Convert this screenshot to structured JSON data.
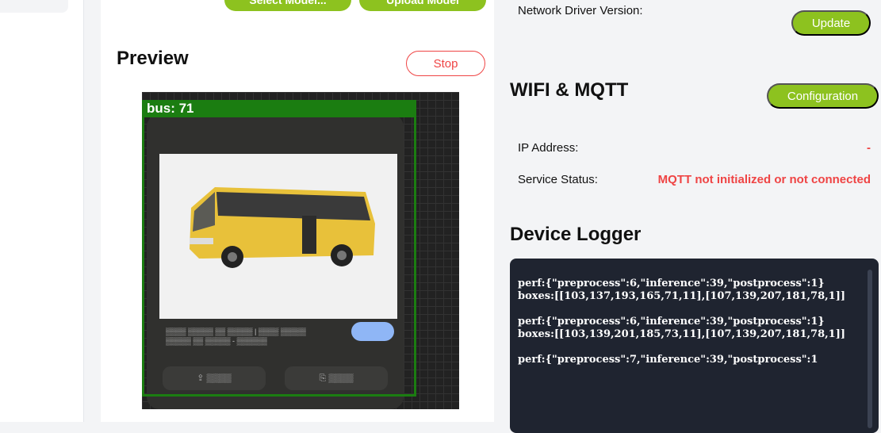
{
  "toolbar": {
    "select_model_label": "Select Model...",
    "upload_model_label": "Upload Model"
  },
  "preview": {
    "title": "Preview",
    "stop_label": "Stop",
    "detection_label": "bus: 71"
  },
  "driver": {
    "label": "Network Driver Version:",
    "update_label": "Update"
  },
  "wifi": {
    "title": "WIFI & MQTT",
    "config_label": "Configuration",
    "ip_label": "IP Address:",
    "ip_value": "-",
    "status_label": "Service Status:",
    "status_value": "MQTT not initialized or not connected"
  },
  "logger": {
    "title": "Device Logger",
    "entries": [
      "perf:{\"preprocess\":6,\"inference\":39,\"postprocess\":1}\nboxes:[[103,137,193,165,71,11],[107,139,207,181,78,1]]",
      "perf:{\"preprocess\":6,\"inference\":39,\"postprocess\":1}\nboxes:[[103,139,201,185,73,11],[107,139,207,181,78,1]]",
      "perf:{\"preprocess\":7,\"inference\":39,\"postprocess\":1"
    ]
  },
  "colors": {
    "accent": "#8dc21f",
    "danger": "#ef4444",
    "detection": "#1b7d11",
    "logger_bg": "#1f2430"
  }
}
